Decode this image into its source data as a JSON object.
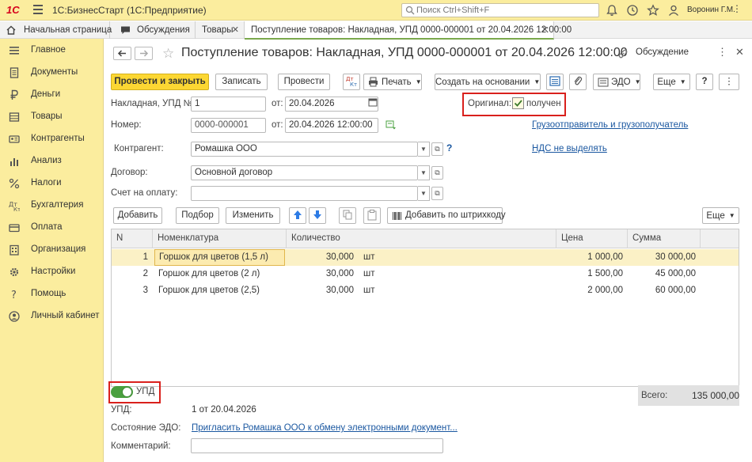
{
  "titlebar": {
    "logo": "1С",
    "app_title": "1С:БизнесСтарт  (1С:Предприятие)",
    "search_placeholder": "Поиск Ctrl+Shift+F",
    "user": "Воронин Г.М."
  },
  "tabs": [
    {
      "label": "Начальная страница"
    },
    {
      "label": "Обсуждения"
    },
    {
      "label": "Товары"
    },
    {
      "label": "Поступление товаров: Накладная, УПД 0000-000001 от 20.04.2026 12:00:00"
    }
  ],
  "sidebar": {
    "items": [
      {
        "label": "Главное",
        "icon": "menu-icon"
      },
      {
        "label": "Документы",
        "icon": "documents-icon"
      },
      {
        "label": "Деньги",
        "icon": "ruble-icon"
      },
      {
        "label": "Товары",
        "icon": "goods-icon"
      },
      {
        "label": "Контрагенты",
        "icon": "counterparties-icon"
      },
      {
        "label": "Анализ",
        "icon": "analysis-icon"
      },
      {
        "label": "Налоги",
        "icon": "percent-icon"
      },
      {
        "label": "Бухгалтерия",
        "icon": "accounting-icon"
      },
      {
        "label": "Оплата",
        "icon": "payment-icon"
      },
      {
        "label": "Организация",
        "icon": "organization-icon"
      },
      {
        "label": "Настройки",
        "icon": "gear-icon"
      },
      {
        "label": "Помощь",
        "icon": "help-icon"
      },
      {
        "label": "Личный кабинет",
        "icon": "user-icon"
      }
    ]
  },
  "form": {
    "title": "Поступление товаров: Накладная, УПД 0000-000001 от 20.04.2026 12:00:00",
    "discussion": "Обсуждение",
    "toolbar": {
      "post_close": "Провести и закрыть",
      "save": "Записать",
      "post": "Провести",
      "print": "Печать",
      "create_based": "Создать на основании",
      "edo": "ЭДО",
      "more": "Еще",
      "help": "?"
    },
    "fields": {
      "invoice_label": "Накладная, УПД №:",
      "invoice_value": "1",
      "from_label": "от:",
      "invoice_date": "20.04.2026",
      "number_label": "Номер:",
      "number_value": "0000-000001",
      "number_date": "20.04.2026 12:00:00",
      "counterparty_label": "Контрагент:",
      "counterparty_value": "Ромашка ООО",
      "contract_label": "Договор:",
      "contract_value": "Основной договор",
      "invoice_pay_label": "Счет на оплату:",
      "invoice_pay_value": ""
    },
    "original": {
      "label": "Оригинал:",
      "value": "получен"
    },
    "links": {
      "shipper": "Грузоотправитель и грузополучатель",
      "vat": "НДС не выделять"
    },
    "table_toolbar": {
      "add": "Добавить",
      "pick": "Подбор",
      "edit": "Изменить",
      "barcode": "Добавить по штрихкоду",
      "more": "Еще"
    },
    "table": {
      "headers": [
        "N",
        "Номенклатура",
        "Количество",
        "Цена",
        "Сумма"
      ],
      "rows": [
        {
          "n": "1",
          "name": "Горшок для цветов (1,5 л)",
          "qty": "30,000",
          "unit": "шт",
          "price": "1 000,00",
          "sum": "30 000,00"
        },
        {
          "n": "2",
          "name": "Горшок для цветов (2 л)",
          "qty": "30,000",
          "unit": "шт",
          "price": "1 500,00",
          "sum": "45 000,00"
        },
        {
          "n": "3",
          "name": "Горшок для цветов (2,5)",
          "qty": "30,000",
          "unit": "шт",
          "price": "2 000,00",
          "sum": "60 000,00"
        }
      ]
    },
    "footer": {
      "upd_toggle": "УПД",
      "total_label": "Всего:",
      "total_value": "135 000,00",
      "upd_label": "УПД:",
      "upd_value": "1 от 20.04.2026",
      "edo_label": "Состояние ЭДО:",
      "edo_value": "Пригласить Ромашка ООО к обмену электронными документ...",
      "comment_label": "Комментарий:",
      "comment_value": ""
    }
  },
  "colors": {
    "panel_yellow": "#fbed9e",
    "primary_button": "#fcd733",
    "highlight_red": "#d9201c",
    "link_blue": "#1a57a0",
    "toggle_green": "#4aa03f"
  }
}
